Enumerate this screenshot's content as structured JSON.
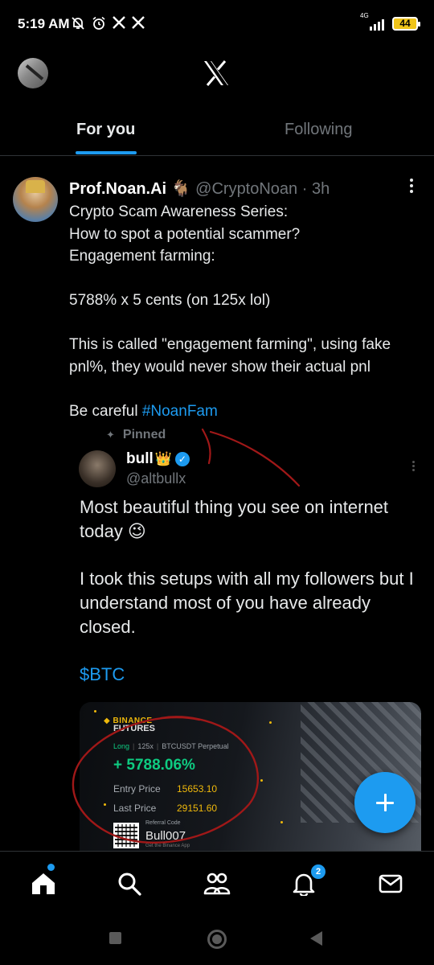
{
  "status_bar": {
    "time": "5:19 AM",
    "notification_icons": [
      "bell-off-icon",
      "alarm-icon",
      "x-icon",
      "x-icon"
    ],
    "network_label": "4G",
    "battery_level": "44"
  },
  "header": {
    "logo": "x-logo-icon"
  },
  "tabs": [
    {
      "label": "For you",
      "active": true
    },
    {
      "label": "Following",
      "active": false
    }
  ],
  "post": {
    "author_name": "Prof.Noan.Ai",
    "author_emoji": "🐐",
    "handle": "@CryptoNoan",
    "separator": "·",
    "time": "3h",
    "lines": [
      "Crypto Scam Awareness Series:",
      "How to spot a potential scammer?",
      "Engagement farming:",
      "5788% x 5 cents (on 125x lol)",
      "This is called \"engagement farming\", using fake pnl%, they would never show their actual pnl",
      "Be careful "
    ],
    "hashtag": "#NoanFam"
  },
  "quoted": {
    "pinned_label": "Pinned",
    "name": "bull",
    "name_emoji": "👑",
    "handle": "@altbullx",
    "lines": [
      "Most beautiful thing you see on internet today 😉",
      "I took this setups with all my followers but I understand most of you have already closed.",
      "$BTC"
    ]
  },
  "trade_card": {
    "brand": "BINANCE",
    "product": "FUTURES",
    "side": "Long",
    "leverage": "125x",
    "pair": "BTCUSDT Perpetual",
    "pnl": "+ 5788.06%",
    "entry_label": "Entry Price",
    "entry_value": "15653.10",
    "last_label": "Last Price",
    "last_value": "29151.60",
    "referral_label": "Referral Code",
    "referral_code": "Bull007",
    "referral_sub": "Get the Binance App"
  },
  "bottom_nav": {
    "items": [
      "home-icon",
      "search-icon",
      "communities-icon",
      "notifications-icon",
      "messages-icon"
    ],
    "notification_count": "2"
  },
  "colors": {
    "accent": "#1d9bf0",
    "pnl_green": "#0ecb81",
    "binance_yellow": "#f0b90b",
    "annotation_red": "#a01818"
  }
}
